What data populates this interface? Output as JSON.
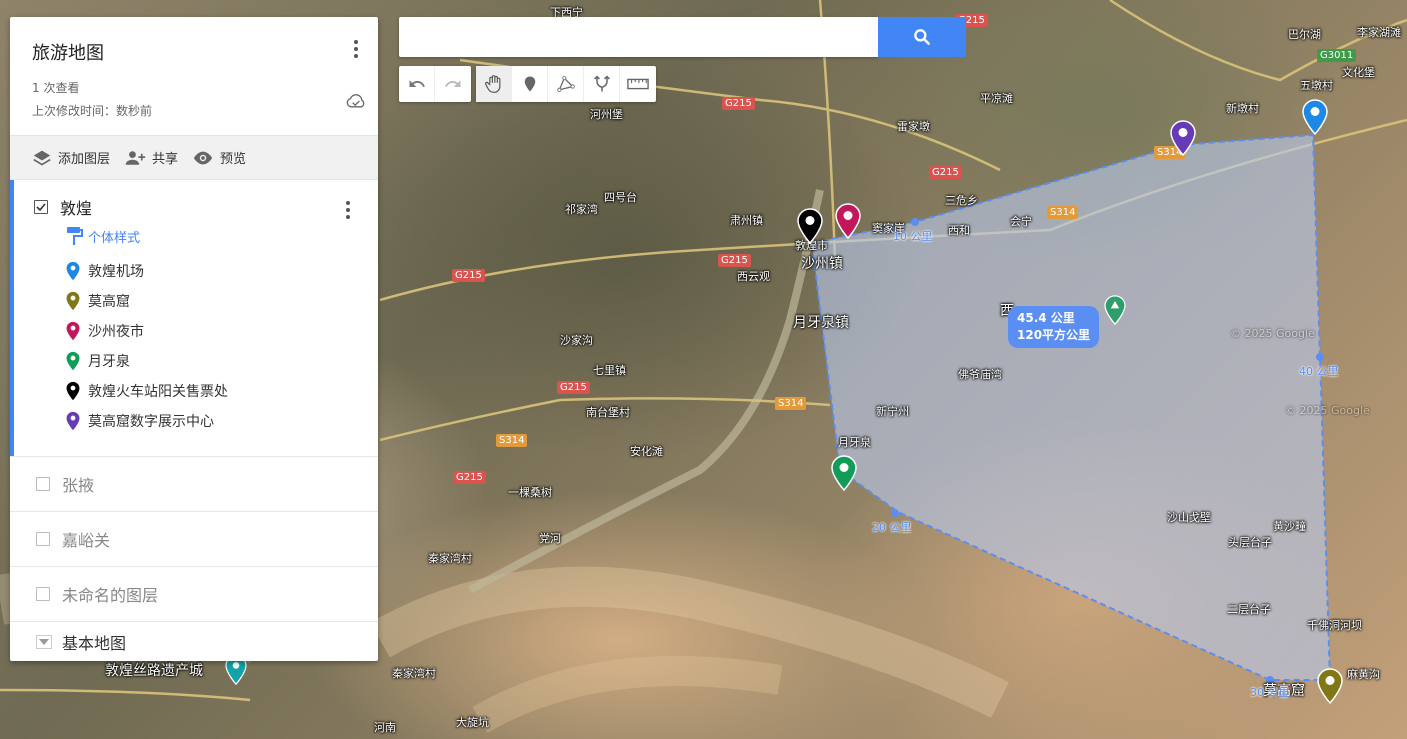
{
  "panel": {
    "title": "旅游地图",
    "views": "1 次查看",
    "modified": "上次修改时间：数秒前",
    "actions": {
      "add_layer": "添加图层",
      "share": "共享",
      "preview": "预览"
    },
    "layers": [
      {
        "name": "敦煌",
        "checked": true,
        "style_label": "个体样式",
        "places": [
          {
            "label": "敦煌机场",
            "color": "#1e88e5"
          },
          {
            "label": "莫高窟",
            "color": "#827717"
          },
          {
            "label": "沙州夜市",
            "color": "#c2185b"
          },
          {
            "label": "月牙泉",
            "color": "#0f9d58"
          },
          {
            "label": "敦煌火车站阳关售票处",
            "color": "#000000"
          },
          {
            "label": "莫高窟数字展示中心",
            "color": "#673ab7"
          }
        ]
      },
      {
        "name": "张掖",
        "checked": false
      },
      {
        "name": "嘉峪关",
        "checked": false
      },
      {
        "name": "未命名的图层",
        "checked": false
      }
    ],
    "basemap_label": "基本地图"
  },
  "search": {
    "placeholder": "",
    "value": ""
  },
  "toolbar": [
    "undo-icon",
    "redo-icon",
    "hand-icon",
    "marker-icon",
    "line-icon",
    "directions-icon",
    "ruler-icon"
  ],
  "map": {
    "measure_distance": "45.4 公里",
    "measure_area": "120平方公里",
    "distance_ticks": [
      "10 公里",
      "20 公里",
      "30 公里",
      "40 公里"
    ],
    "places": [
      {
        "text": "下西宁"
      },
      {
        "text": "巴尔湖"
      },
      {
        "text": "李家湖滩"
      },
      {
        "text": "文化堡"
      },
      {
        "text": "五墩村"
      },
      {
        "text": "新墩村"
      },
      {
        "text": "平凉滩"
      },
      {
        "text": "雷家墩"
      },
      {
        "text": "三危乡"
      },
      {
        "text": "会宁"
      },
      {
        "text": "西和"
      },
      {
        "text": "河州堡"
      },
      {
        "text": "四号台"
      },
      {
        "text": "祁家湾"
      },
      {
        "text": "肃州镇"
      },
      {
        "text": "敦煌市"
      },
      {
        "text": "沙州镇"
      },
      {
        "text": "西云观"
      },
      {
        "text": "月牙泉镇"
      },
      {
        "text": "沙家沟"
      },
      {
        "text": "七里镇"
      },
      {
        "text": "南台堡村"
      },
      {
        "text": "安化滩"
      },
      {
        "text": "一棵桑树"
      },
      {
        "text": "党河"
      },
      {
        "text": "秦家湾村"
      },
      {
        "text": "秦家湾村"
      },
      {
        "text": "河南"
      },
      {
        "text": "大旋坑"
      },
      {
        "text": "佛爷庙湾"
      },
      {
        "text": "新宁州"
      },
      {
        "text": "月牙泉"
      },
      {
        "text": "沙山戈壁"
      },
      {
        "text": "黄沙疃"
      },
      {
        "text": "头层台子"
      },
      {
        "text": "二层台子"
      },
      {
        "text": "千佛洞河坝"
      },
      {
        "text": "麻黄沟"
      },
      {
        "text": "敦煌丝路遗产城"
      },
      {
        "text": "莫高窟"
      },
      {
        "text": "西"
      },
      {
        "text": "窦家崖"
      }
    ],
    "roads": [
      "G215",
      "G215",
      "G215",
      "G215",
      "G215",
      "G215",
      "S314",
      "S314",
      "S314",
      "S314",
      "G3011"
    ],
    "watermarks": [
      "© 2025 Google",
      "© 2025 Google"
    ]
  }
}
